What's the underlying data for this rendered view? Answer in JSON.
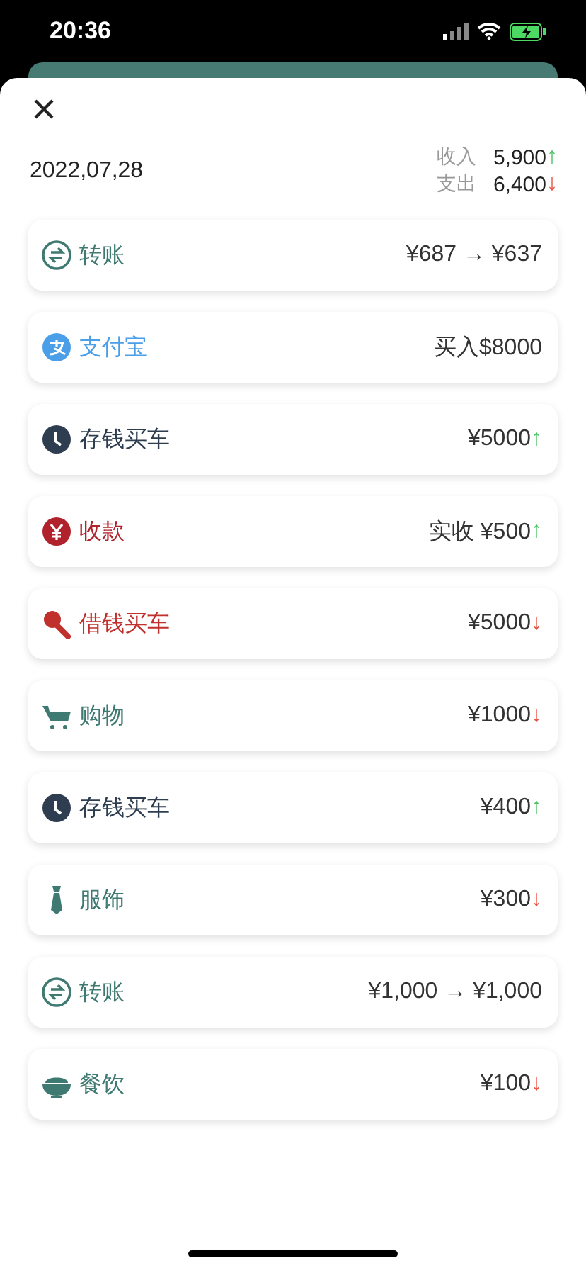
{
  "status_bar": {
    "time": "20:36"
  },
  "sheet": {
    "date": "2022,07,28",
    "summary": [
      {
        "label": "收入",
        "value": "5,900",
        "arrow": {
          "symbol": "↑",
          "color": "#4cc265"
        }
      },
      {
        "label": "支出",
        "value": "6,400",
        "arrow": {
          "symbol": "↓",
          "color": "#e8503f"
        }
      }
    ]
  },
  "entries": [
    {
      "kind": "transfer",
      "title": "转账",
      "color": "#3f7a72",
      "amount": "¥687 → ¥637"
    },
    {
      "kind": "alipay",
      "title": "支付宝",
      "color": "#4a9fe8",
      "amount": "买入$8000"
    },
    {
      "kind": "clock",
      "title": "存钱买车",
      "color": "#2e3e50",
      "amount": "¥5000",
      "arrow": {
        "symbol": "↑",
        "color": "#4cc265"
      }
    },
    {
      "kind": "yen",
      "title": "收款",
      "color": "#b0222c",
      "amount": "实收 ¥500",
      "arrow": {
        "symbol": "↑",
        "color": "#4cc265"
      }
    },
    {
      "kind": "microphone",
      "title": "借钱买车",
      "color": "#c0302c",
      "amount": "¥5000",
      "arrow": {
        "symbol": "↓",
        "color": "#e8503f"
      }
    },
    {
      "kind": "cart",
      "title": "购物",
      "color": "#3f7a72",
      "amount": "¥1000",
      "arrow": {
        "symbol": "↓",
        "color": "#e8503f"
      }
    },
    {
      "kind": "clock",
      "title": "存钱买车",
      "color": "#2e3e50",
      "amount": "¥400",
      "arrow": {
        "symbol": "↑",
        "color": "#4cc265"
      }
    },
    {
      "kind": "tie",
      "title": "服饰",
      "color": "#3f7a72",
      "amount": "¥300",
      "arrow": {
        "symbol": "↓",
        "color": "#e8503f"
      }
    },
    {
      "kind": "transfer",
      "title": "转账",
      "color": "#3f7a72",
      "amount": "¥1,000 → ¥1,000"
    },
    {
      "kind": "bowl",
      "title": "餐饮",
      "color": "#3f7a72",
      "amount": "¥100",
      "arrow": {
        "symbol": "↓",
        "color": "#e8503f"
      }
    }
  ]
}
